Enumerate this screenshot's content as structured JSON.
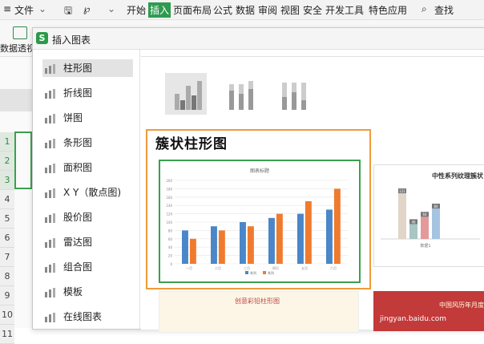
{
  "menubar": {
    "file": "文件",
    "items": [
      "开始",
      "插入",
      "页面布局",
      "公式",
      "数据",
      "审阅",
      "视图",
      "安全",
      "开发工具",
      "特色应用"
    ],
    "search": "查找"
  },
  "ribbon": {
    "pivot_label": "数据透视"
  },
  "sheet": {
    "rows": [
      "1",
      "2",
      "3",
      "4",
      "5",
      "6",
      "7",
      "8",
      "9",
      "10",
      "11"
    ]
  },
  "dialog": {
    "title": "插入图表",
    "logo": "S",
    "types": [
      "柱形图",
      "折线图",
      "饼图",
      "条形图",
      "面积图",
      "X Y（散点图)",
      "股价图",
      "雷达图",
      "组合图",
      "模板",
      "在线图表"
    ],
    "selected_type": 0,
    "variant_title": "簇状柱形图",
    "preview2_title": "中性系列纹理簇状",
    "preview3_title": "创意彩铅柱形图",
    "preview4_title": "中国风历年月度"
  },
  "chart_data": {
    "type": "bar",
    "title": "图表标题",
    "categories": [
      "一月",
      "二月",
      "三月",
      "四月",
      "五月",
      "六月"
    ],
    "series": [
      {
        "name": "系列",
        "color": "#4a86c8",
        "values": [
          80,
          90,
          100,
          110,
          120,
          130
        ]
      },
      {
        "name": "系列",
        "color": "#ef7b2e",
        "values": [
          60,
          80,
          90,
          120,
          150,
          180
        ]
      }
    ],
    "yticks": [
      0,
      20,
      40,
      60,
      80,
      100,
      120,
      140,
      160,
      180,
      200
    ],
    "ylim": [
      0,
      200
    ],
    "grid": true,
    "legend": "bottom"
  },
  "preview2_data": {
    "values": [
      121,
      46,
      64,
      84
    ],
    "colors": [
      "#e0d5c6",
      "#a8c6c3",
      "#e29a9a",
      "#a4c4e1"
    ],
    "xlabel": "数据1"
  },
  "watermark": "jingyan.baidu.com"
}
